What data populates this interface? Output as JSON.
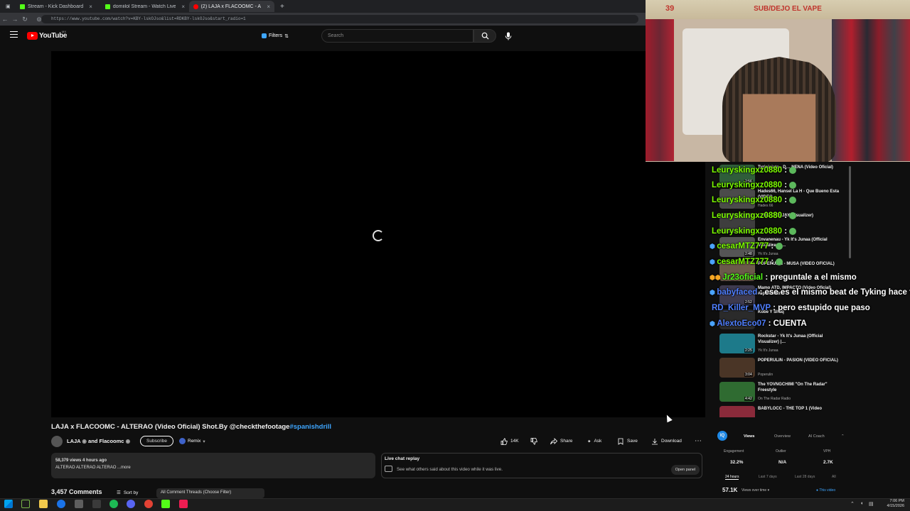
{
  "browser": {
    "tabs": [
      {
        "label": "Stream - Kick Dashboard",
        "color": "#53fc18"
      },
      {
        "label": "domiilol Stream - Watch Live on Kick",
        "color": "#53fc18"
      },
      {
        "label": "(2) LAJA x FLACOOMC - ALTERAO",
        "color": "#ff0000"
      }
    ],
    "new_tab": "+",
    "url": "https://www.youtube.com/watch?v=KBY-lskOJso&list=RDKBY-lskOJso&start_radio=1"
  },
  "yt": {
    "logo_text": "YouTube",
    "logo_sup": "MX",
    "filters_label": "Filters",
    "search_placeholder": "Search"
  },
  "video": {
    "title": "LAJA x FLACOOMC - ALTERAO (Video Oficial) Shot.By @checkthefootage",
    "hashtag": "#spanishdrill",
    "channel": "LAJA",
    "collab": "and Flacoomc",
    "subscribe": "Subscribe",
    "remix": "Remix",
    "likes": "14K",
    "share": "Share",
    "ask": "Ask",
    "save": "Save",
    "download": "Download",
    "more": "⋯",
    "views_line": "58,379 views  4 hours ago",
    "desc_line": "ALTERAO ALTERAO ALTERAO ...more"
  },
  "live_chat": {
    "title": "Live chat replay",
    "sub": "See what others said about this video while it was live.",
    "button": "Open panel"
  },
  "comments": {
    "count": "3,457 Comments",
    "sort": "Sort by",
    "filter": "All Comment Threads (Choose Filter)"
  },
  "stream_overlay": {
    "counter": "39",
    "banner": "SUB/DEJO EL VAPE"
  },
  "chat": [
    {
      "user": "Leuryskingxz0880",
      "msg": ":"
    },
    {
      "user": "Leuryskingxz0880",
      "msg": ":"
    },
    {
      "user": "Leuryskingxz0880",
      "msg": ":"
    },
    {
      "user": "Leuryskingxz0880",
      "msg": ":"
    },
    {
      "user": "Leuryskingxz0880",
      "msg": ":"
    },
    {
      "user": "cesarMTZ777",
      "msg": ":"
    },
    {
      "user": "cesarMTZ777",
      "msg": ":"
    },
    {
      "user": "Jr23oficial",
      "msg": ": preguntale a el mismo"
    },
    {
      "user": "babyfaced",
      "msg": ": ese es el mismo beat de Tyking hace tres a"
    },
    {
      "user": "RD_Killer_MVP",
      "msg": ": pero estupido que paso"
    },
    {
      "user": "AlextoEco07",
      "msg": ": CUENTA"
    }
  ],
  "recommended": [
    {
      "title": "Tyrinisiato - D… NENA (Video Oficial)",
      "channel": "",
      "dur": "2:56"
    },
    {
      "title": "Hades66, Hansel La H - Que Bueno Esta (VIDEO…",
      "channel": "Hades 66",
      "dur": ""
    },
    {
      "title": "… W… TTS JAY (visualizer)",
      "channel": "",
      "dur": ""
    },
    {
      "title": "Envanenau - Yk It's Junaa (Official Visualizer) |…",
      "channel": "Yk It's Junaa",
      "dur": "2:48"
    },
    {
      "title": "POPERULIN - MUSA (VIDEO OFICIAL)",
      "channel": "",
      "dur": ""
    },
    {
      "title": "Mamo ATD, IMPACTO (Video Oficial) #spanishdrill",
      "channel": "",
      "dur": "2:52"
    },
    {
      "title": "Kobe Y Shaq",
      "channel": "",
      "dur": ""
    },
    {
      "title": "Rockstar - Yk It's Junaa (Official Visualizer) |…",
      "channel": "Yk It's Junaa",
      "dur": "2:25"
    },
    {
      "title": "POPERULIN - PASION (VIDEO OFICIAL)",
      "channel": "Poperulin",
      "dur": "3:04"
    },
    {
      "title": "The YOVNGCHIMI \"On The Radar\" Freestyle",
      "channel": "On The Radar Radio",
      "dur": "4:42"
    },
    {
      "title": "BABYLOCC - THE TOP 1 (Video",
      "channel": "",
      "dur": ""
    }
  ],
  "analytics": {
    "logo": "IQ",
    "tabs": [
      "Views",
      "Overview",
      "AI Coach"
    ],
    "headers": [
      "Engagement",
      "Outlier",
      "VPH"
    ],
    "values": [
      "32.2%",
      "N/A",
      "2.7K"
    ],
    "ranges": [
      "24 hours",
      "Last 7 days",
      "Last 28 days",
      "All"
    ],
    "total": "57.1K",
    "total_label": "Views over time",
    "this_video": "This video"
  },
  "clock": {
    "time": "7:06 PM",
    "date": "4/15/2026"
  }
}
